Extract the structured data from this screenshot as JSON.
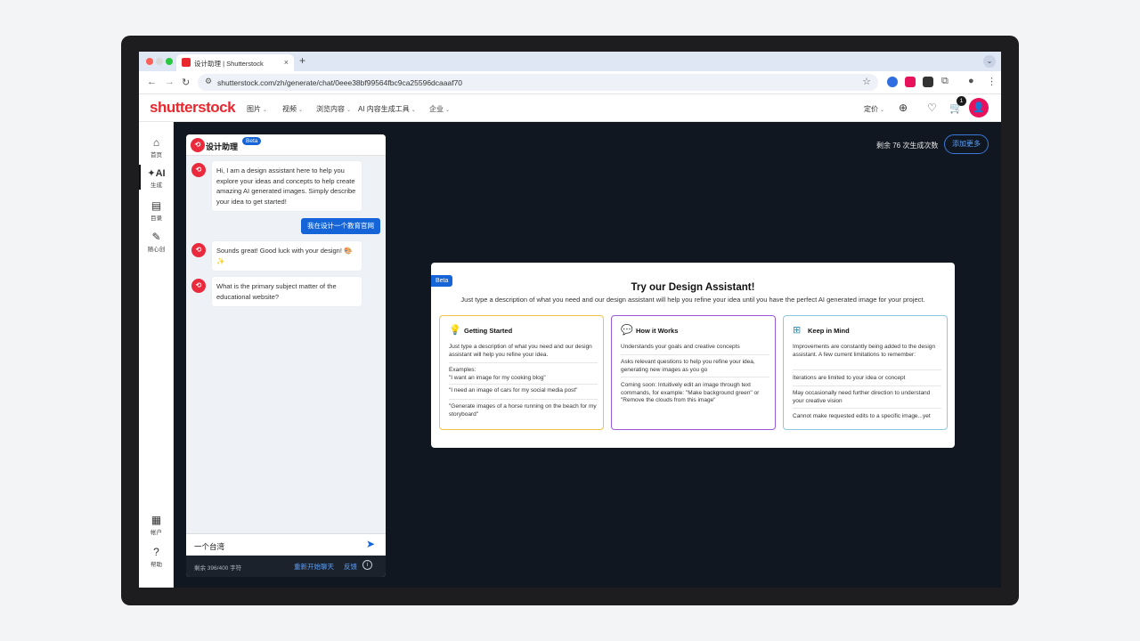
{
  "browser": {
    "tab_title": "设计助理 | Shutterstock",
    "tab_close": "×",
    "new_tab": "+",
    "tab_menu": "⌄",
    "back": "←",
    "forward": "→",
    "reload": "↻",
    "url": "shutterstock.com/zh/generate/chat/0eee38bf99564fbc9ca25596dcaaaf70",
    "bookmark_star": "☆",
    "more_menu": "⋮"
  },
  "site": {
    "logo": "shutterstock",
    "menu": [
      "图片",
      "视频",
      "浏览内容",
      "AI 内容生成工具",
      "企业"
    ],
    "pricing": "定价",
    "cart_count": "1"
  },
  "rail": {
    "items": [
      {
        "label": "首页",
        "icon": "⌂"
      },
      {
        "label": "生成",
        "icon": "✦AI"
      },
      {
        "label": "目录",
        "icon": "▤"
      },
      {
        "label": "随心创",
        "icon": "✎"
      }
    ],
    "bottom": [
      {
        "label": "帐户",
        "icon": "▦"
      },
      {
        "label": "帮助",
        "icon": "?"
      }
    ]
  },
  "chat": {
    "title": "设计助理",
    "beta": "Beta",
    "bot_intro": "Hi, I am a design assistant here to help you explore your ideas and concepts to help create amazing AI generated images. Simply describe your idea to get started!",
    "user_msg": "我在设计一个教育官网",
    "bot_reply": "Sounds great! Good luck with your design! 🎨✨",
    "bot_question": "What is the primary subject matter of the educational website?",
    "input_value": "一个台湾",
    "char_count": "剩余 396/400 字符",
    "restart": "重新开始聊天",
    "feedback": "反馈",
    "info": "i"
  },
  "credits": {
    "remaining": "剩余 76 次生成次数",
    "add_more": "添加更多"
  },
  "assistant_card": {
    "beta": "Beta",
    "title": "Try our Design Assistant!",
    "subtitle": "Just type a description of what you need and our design assistant will help you refine your idea until you have the perfect AI generated image for your project.",
    "columns": [
      {
        "title": "Getting Started",
        "icon": "bulb-icon",
        "border": "#f2c14e",
        "icon_color": "#e8a317",
        "items": [
          "Just type a description of what you need and our design assistant will help you refine your idea.",
          "Examples:\n\"I want an image for my cooking blog\"",
          "\"I need an image of cars for my social media post\"",
          "\"Generate images of a horse running on the beach for my storyboard\""
        ]
      },
      {
        "title": "How it Works",
        "icon": "chat-icon",
        "border": "#9b59d6",
        "icon_color": "#7b3fc4",
        "items": [
          "Understands your goals and creative concepts",
          "Asks relevant questions to help you refine your idea, generating new images as you go",
          "Coming soon: Intuitively edit an image through text commands, for example: \"Make background green\" or \"Remove the clouds from this image\""
        ]
      },
      {
        "title": "Keep in Mind",
        "icon": "grid-icon",
        "border": "#8fc8e0",
        "icon_color": "#2f8fbf",
        "items": [
          "Improvements are constantly being added to the design assistant. A few current limitations to remember:",
          "Iterations are limited to your idea or concept",
          "May occasionally need further direction to understand your creative vision",
          "Cannot make requested edits to a specific image...yet"
        ]
      }
    ]
  }
}
